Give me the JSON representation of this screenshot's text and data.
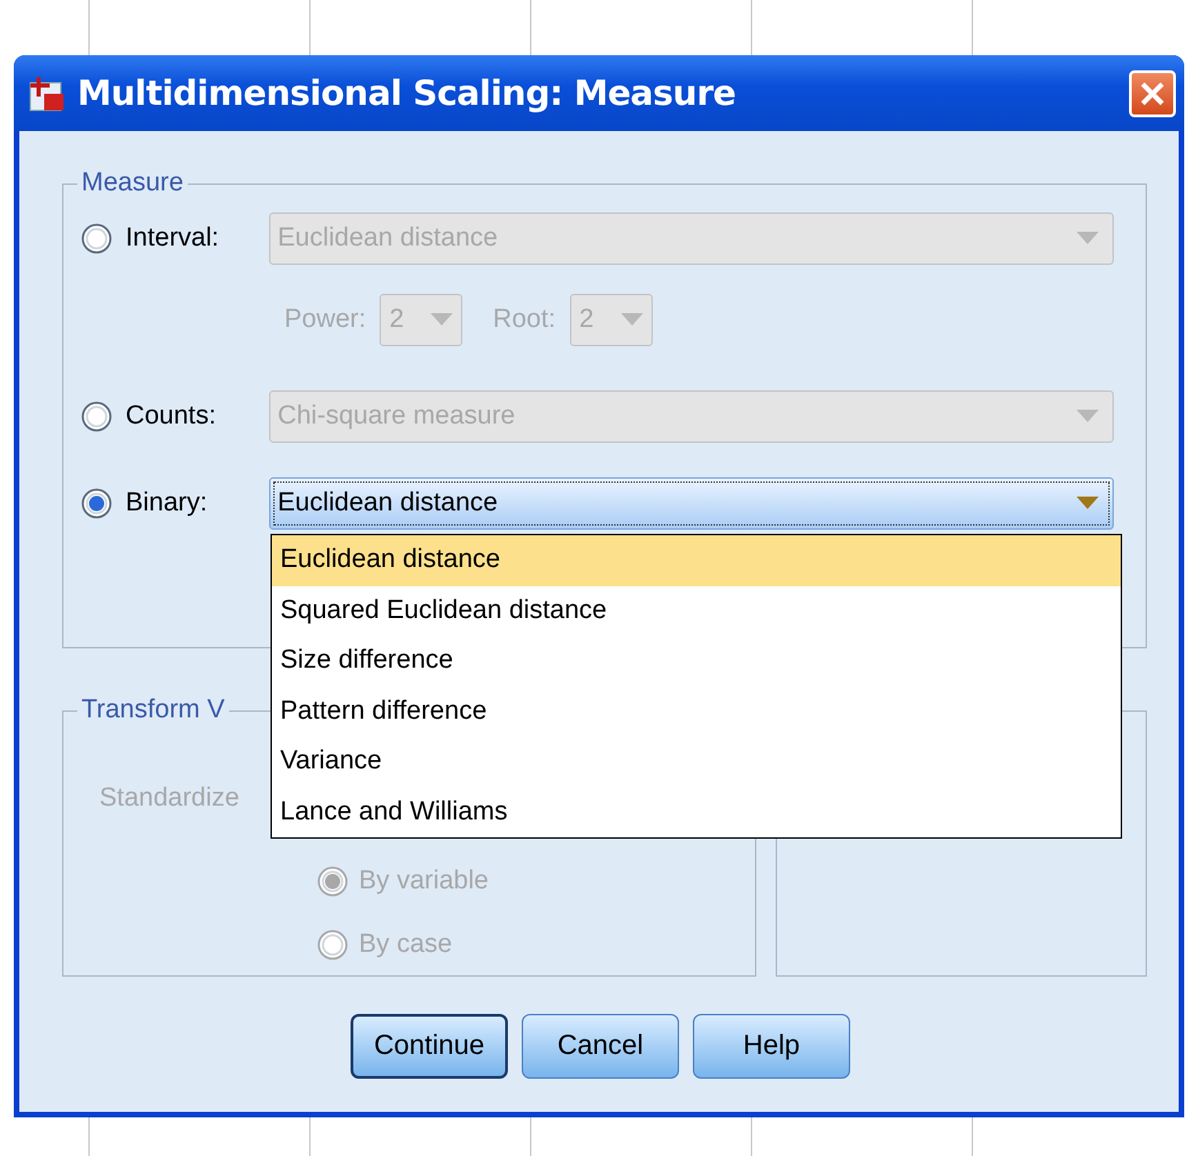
{
  "window": {
    "title": "Multidimensional Scaling: Measure"
  },
  "measure": {
    "label": "Measure",
    "options": [
      {
        "kind": "combo",
        "label": "Interval:",
        "selected": false,
        "value": "Euclidean distance",
        "expanded": false
      },
      {
        "kind": "power_root",
        "power": {
          "label": "Power:",
          "value": "2"
        },
        "root": {
          "label": "Root:",
          "value": "2"
        }
      },
      {
        "kind": "combo",
        "label": "Counts:",
        "selected": false,
        "value": "Chi-square measure",
        "expanded": false
      },
      {
        "kind": "combo",
        "label": "Binary:",
        "selected": true,
        "value": "Euclidean distance",
        "expanded": true,
        "list": [
          {
            "label": "Euclidean distance",
            "selected": true
          },
          {
            "label": "Squared Euclidean distance",
            "selected": false
          },
          {
            "label": "Size difference",
            "selected": false
          },
          {
            "label": "Pattern difference",
            "selected": false
          },
          {
            "label": "Variance",
            "selected": false
          },
          {
            "label": "Lance and Williams",
            "selected": false
          }
        ]
      }
    ]
  },
  "transform": {
    "label": "Transform V",
    "standardize_label": "Standardize",
    "options": [
      {
        "label": "By variable",
        "selected": true
      },
      {
        "label": "By case",
        "selected": false
      }
    ]
  },
  "buttons": [
    {
      "label": "Continue",
      "default": true
    },
    {
      "label": "Cancel",
      "default": false
    },
    {
      "label": "Help",
      "default": false
    }
  ]
}
